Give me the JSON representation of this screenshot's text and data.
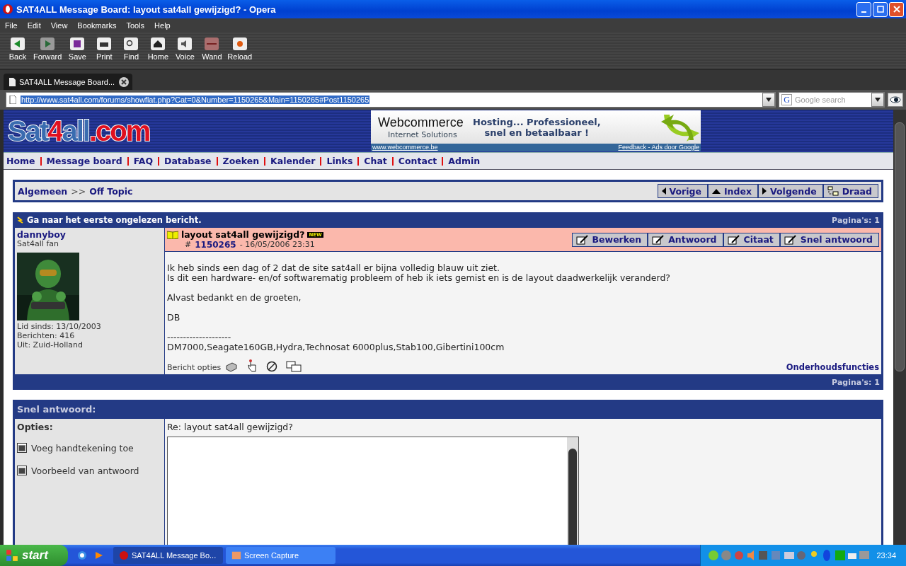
{
  "window": {
    "title": "SAT4ALL Message Board: layout sat4all gewijzigd? - Opera"
  },
  "menu": [
    "File",
    "Edit",
    "View",
    "Bookmarks",
    "Tools",
    "Help"
  ],
  "toolbar": [
    {
      "label": "Back",
      "kind": "back"
    },
    {
      "label": "Forward",
      "kind": "forward"
    },
    {
      "label": "Save",
      "kind": "save"
    },
    {
      "label": "Print",
      "kind": "print"
    },
    {
      "label": "Find",
      "kind": "find"
    },
    {
      "label": "Home",
      "kind": "home"
    },
    {
      "label": "Voice",
      "kind": "voice"
    },
    {
      "label": "Wand",
      "kind": "wand"
    },
    {
      "label": "Reload",
      "kind": "reload"
    }
  ],
  "tabs": [
    {
      "label": "SAT4ALL Message Board...",
      "selected": true
    }
  ],
  "address": {
    "value": "http://www.sat4all.com/forums/showflat.php?Cat=0&Number=1150265&Main=1150265#Post1150265"
  },
  "search": {
    "engine": "G",
    "placeholder": "Google search"
  },
  "site": {
    "logo": [
      "Sat",
      "4",
      "all",
      ".com"
    ],
    "ad": {
      "brand": "Webcommerce",
      "tagline": "Internet Solutions",
      "headline": [
        "Hosting... Professioneel,",
        "snel en betaalbaar !"
      ],
      "url": "www.webcommerce.be",
      "feedback": "Feedback - Ads door Google"
    },
    "nav": [
      "Home",
      "Message board",
      "FAQ",
      "Database",
      "Zoeken",
      "Kalender",
      "Links",
      "Chat",
      "Contact",
      "Admin"
    ]
  },
  "breadcrumb": {
    "parts": [
      "Algemeen",
      "Off Topic"
    ],
    "separator": ">>"
  },
  "thread_nav": [
    {
      "label": "Vorige",
      "kind": "left"
    },
    {
      "label": "Index",
      "kind": "up"
    },
    {
      "label": "Volgende",
      "kind": "right"
    },
    {
      "label": "Draad",
      "kind": "tree"
    }
  ],
  "post_header": {
    "link": "Ga naar het eerste ongelezen bericht.",
    "pages": "Pagina's: 1"
  },
  "post": {
    "author": "dannyboy",
    "rank": "Sat4all fan",
    "member_since": "Lid sinds: 13/10/2003",
    "posts": "Berichten: 416",
    "location": "Uit: Zuid-Holland",
    "subject": "layout sat4all gewijzigd?",
    "new": "NEW",
    "number_prefix": "#",
    "number": "1150265",
    "date": "- 16/05/2006 23:31",
    "actions": [
      "Bewerken",
      "Antwoord",
      "Citaat",
      "Snel antwoord"
    ],
    "body": [
      [
        "Ik heb sinds een dag of 2 dat de site sat4all er bijna volledig blauw uit ziet.",
        "Is dit een hardware- en/of softwarematig probleem of heb ik iets gemist en is de layout daadwerkelijk veranderd?"
      ],
      [
        "Alvast bedankt en de groeten,"
      ],
      [
        "DB"
      ],
      [
        "--------------------",
        "DM7000,Seagate160GB,Hydra,Technosat 6000plus,Stab100,Gibertini100cm"
      ]
    ],
    "options_label": "Bericht opties",
    "maintenance": "Onderhoudsfuncties"
  },
  "post_footer": {
    "pages": "Pagina's: 1"
  },
  "quick_reply": {
    "title": "Snel antwoord:",
    "options_label": "Opties:",
    "options": [
      {
        "label": "Voeg handtekening toe",
        "checked": true
      },
      {
        "label": "Voorbeeld van antwoord",
        "checked": true
      }
    ],
    "subject": "Re: layout sat4all gewijzigd?"
  },
  "taskbar": {
    "start": "start",
    "tasks": [
      {
        "label": "SAT4ALL Message Bo...",
        "selected": true
      },
      {
        "label": "Screen Capture",
        "selected": false
      }
    ],
    "time": "23:34"
  }
}
